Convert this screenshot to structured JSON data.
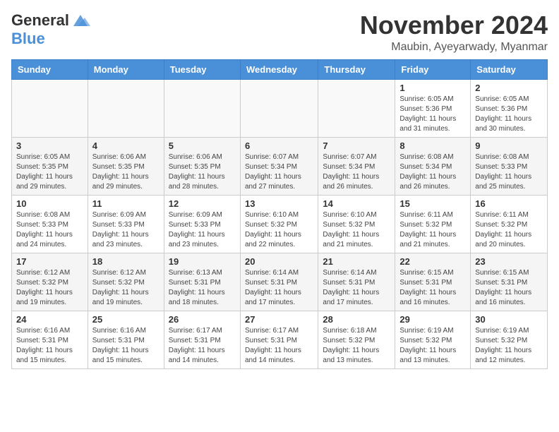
{
  "header": {
    "logo": {
      "general": "General",
      "blue": "Blue"
    },
    "title": "November 2024",
    "location": "Maubin, Ayeyarwady, Myanmar"
  },
  "weekdays": [
    "Sunday",
    "Monday",
    "Tuesday",
    "Wednesday",
    "Thursday",
    "Friday",
    "Saturday"
  ],
  "weeks": [
    [
      {
        "day": "",
        "info": ""
      },
      {
        "day": "",
        "info": ""
      },
      {
        "day": "",
        "info": ""
      },
      {
        "day": "",
        "info": ""
      },
      {
        "day": "",
        "info": ""
      },
      {
        "day": "1",
        "info": "Sunrise: 6:05 AM\nSunset: 5:36 PM\nDaylight: 11 hours and 31 minutes."
      },
      {
        "day": "2",
        "info": "Sunrise: 6:05 AM\nSunset: 5:36 PM\nDaylight: 11 hours and 30 minutes."
      }
    ],
    [
      {
        "day": "3",
        "info": "Sunrise: 6:05 AM\nSunset: 5:35 PM\nDaylight: 11 hours and 29 minutes."
      },
      {
        "day": "4",
        "info": "Sunrise: 6:06 AM\nSunset: 5:35 PM\nDaylight: 11 hours and 29 minutes."
      },
      {
        "day": "5",
        "info": "Sunrise: 6:06 AM\nSunset: 5:35 PM\nDaylight: 11 hours and 28 minutes."
      },
      {
        "day": "6",
        "info": "Sunrise: 6:07 AM\nSunset: 5:34 PM\nDaylight: 11 hours and 27 minutes."
      },
      {
        "day": "7",
        "info": "Sunrise: 6:07 AM\nSunset: 5:34 PM\nDaylight: 11 hours and 26 minutes."
      },
      {
        "day": "8",
        "info": "Sunrise: 6:08 AM\nSunset: 5:34 PM\nDaylight: 11 hours and 26 minutes."
      },
      {
        "day": "9",
        "info": "Sunrise: 6:08 AM\nSunset: 5:33 PM\nDaylight: 11 hours and 25 minutes."
      }
    ],
    [
      {
        "day": "10",
        "info": "Sunrise: 6:08 AM\nSunset: 5:33 PM\nDaylight: 11 hours and 24 minutes."
      },
      {
        "day": "11",
        "info": "Sunrise: 6:09 AM\nSunset: 5:33 PM\nDaylight: 11 hours and 23 minutes."
      },
      {
        "day": "12",
        "info": "Sunrise: 6:09 AM\nSunset: 5:33 PM\nDaylight: 11 hours and 23 minutes."
      },
      {
        "day": "13",
        "info": "Sunrise: 6:10 AM\nSunset: 5:32 PM\nDaylight: 11 hours and 22 minutes."
      },
      {
        "day": "14",
        "info": "Sunrise: 6:10 AM\nSunset: 5:32 PM\nDaylight: 11 hours and 21 minutes."
      },
      {
        "day": "15",
        "info": "Sunrise: 6:11 AM\nSunset: 5:32 PM\nDaylight: 11 hours and 21 minutes."
      },
      {
        "day": "16",
        "info": "Sunrise: 6:11 AM\nSunset: 5:32 PM\nDaylight: 11 hours and 20 minutes."
      }
    ],
    [
      {
        "day": "17",
        "info": "Sunrise: 6:12 AM\nSunset: 5:32 PM\nDaylight: 11 hours and 19 minutes."
      },
      {
        "day": "18",
        "info": "Sunrise: 6:12 AM\nSunset: 5:32 PM\nDaylight: 11 hours and 19 minutes."
      },
      {
        "day": "19",
        "info": "Sunrise: 6:13 AM\nSunset: 5:31 PM\nDaylight: 11 hours and 18 minutes."
      },
      {
        "day": "20",
        "info": "Sunrise: 6:14 AM\nSunset: 5:31 PM\nDaylight: 11 hours and 17 minutes."
      },
      {
        "day": "21",
        "info": "Sunrise: 6:14 AM\nSunset: 5:31 PM\nDaylight: 11 hours and 17 minutes."
      },
      {
        "day": "22",
        "info": "Sunrise: 6:15 AM\nSunset: 5:31 PM\nDaylight: 11 hours and 16 minutes."
      },
      {
        "day": "23",
        "info": "Sunrise: 6:15 AM\nSunset: 5:31 PM\nDaylight: 11 hours and 16 minutes."
      }
    ],
    [
      {
        "day": "24",
        "info": "Sunrise: 6:16 AM\nSunset: 5:31 PM\nDaylight: 11 hours and 15 minutes."
      },
      {
        "day": "25",
        "info": "Sunrise: 6:16 AM\nSunset: 5:31 PM\nDaylight: 11 hours and 15 minutes."
      },
      {
        "day": "26",
        "info": "Sunrise: 6:17 AM\nSunset: 5:31 PM\nDaylight: 11 hours and 14 minutes."
      },
      {
        "day": "27",
        "info": "Sunrise: 6:17 AM\nSunset: 5:31 PM\nDaylight: 11 hours and 14 minutes."
      },
      {
        "day": "28",
        "info": "Sunrise: 6:18 AM\nSunset: 5:32 PM\nDaylight: 11 hours and 13 minutes."
      },
      {
        "day": "29",
        "info": "Sunrise: 6:19 AM\nSunset: 5:32 PM\nDaylight: 11 hours and 13 minutes."
      },
      {
        "day": "30",
        "info": "Sunrise: 6:19 AM\nSunset: 5:32 PM\nDaylight: 11 hours and 12 minutes."
      }
    ]
  ]
}
